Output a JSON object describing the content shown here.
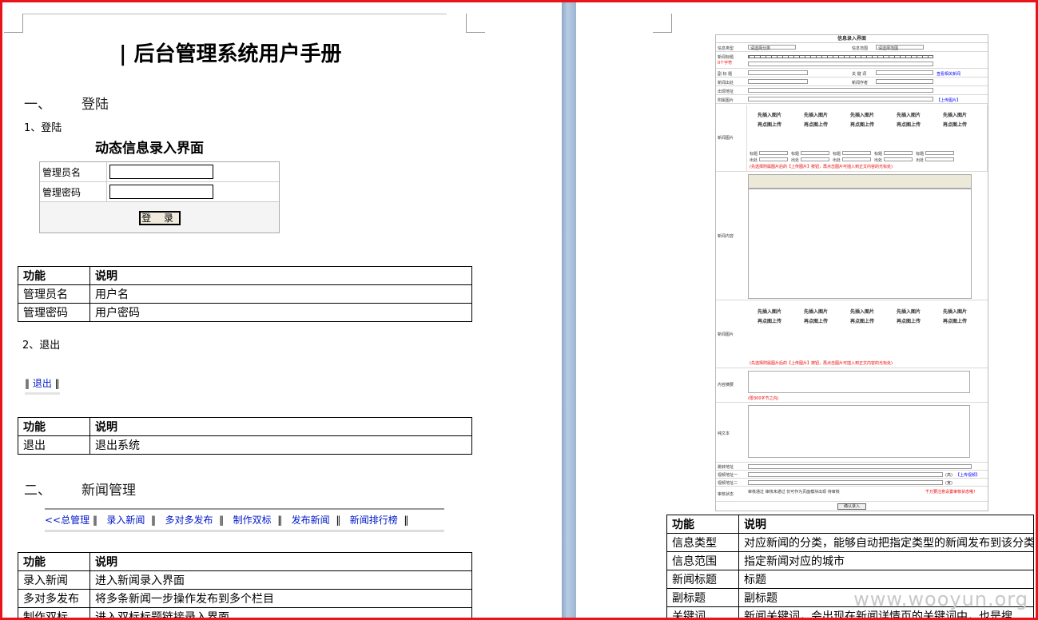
{
  "left": {
    "title": "| 后台管理系统用户手册",
    "section1": {
      "num": "一、",
      "label": "登陆"
    },
    "sub1": "1、登陆",
    "login": {
      "heading": "动态信息录入界面",
      "user_label": "管理员名",
      "pass_label": "管理密码",
      "button": "登 录"
    },
    "table1": {
      "headers": [
        "功能",
        "说明"
      ],
      "rows": [
        [
          "管理员名",
          "用户名"
        ],
        [
          "管理密码",
          "用户密码"
        ]
      ]
    },
    "sub2": "2、退出",
    "logout_link": "退出",
    "table2": {
      "headers": [
        "功能",
        "说明"
      ],
      "rows": [
        [
          "退出",
          "退出系统"
        ]
      ]
    },
    "section2": {
      "num": "二、",
      "label": "新闻管理"
    },
    "nav": [
      "<<总管理",
      "录入新闻",
      "多对多发布",
      "制作双标",
      "发布新闻",
      "新闻排行榜"
    ],
    "table3": {
      "headers": [
        "功能",
        "说明"
      ],
      "rows": [
        [
          "录入新闻",
          "进入新闻录入界面"
        ],
        [
          "多对多发布",
          "将多条新闻一步操作发布到多个栏目"
        ],
        [
          "制作双标",
          "进入双标标题链接录入界面"
        ]
      ]
    }
  },
  "right": {
    "shot": {
      "title": "信息录入界面",
      "rows": {
        "type": "信息类型",
        "type_sel": "请选择分类",
        "range": "信息范围",
        "range_sel": "请选择范围",
        "headline": "新闻标题",
        "headline_note": "0个字符",
        "subtitle": "副 标 题",
        "keyword": "关 键 词",
        "keyword_link": "查看相关新闻",
        "source": "新闻出处",
        "author": "新闻作者",
        "addr": "出现地址",
        "attach": "附属图片",
        "attach_link": "【上传图片】",
        "news_img": "新闻图片",
        "img_hint1": "先插入图片",
        "img_hint2": "再点图上传",
        "cap_title": "标题",
        "cap_src": "出处",
        "img_note": "(先选择附属图片后的【上传图片】按钮，再点击图片可插入到正文内容的光标处)",
        "content": "新闻内容",
        "summary": "内容摘要",
        "summary_note": "(限300字节之内)",
        "plain": "纯文本",
        "jump": "跳转地址",
        "video1": "视频地址一",
        "video1_link": "【上传视频】",
        "video2": "视频地址二",
        "video_unit": "(高)",
        "video_unit2": "(宽)",
        "audit": "审核状态",
        "audit_opts": "审核通过   审核未通过   仅可作为页面模块出现   待审核",
        "audit_note": "千万要注意设置审核状态哦！",
        "submit": "确认录入"
      }
    },
    "table": {
      "headers": [
        "功能",
        "说明"
      ],
      "rows": [
        [
          "信息类型",
          "对应新闻的分类，能够自动把指定类型的新闻发布到该分类"
        ],
        [
          "信息范围",
          "指定新闻对应的城市"
        ],
        [
          "新闻标题",
          "标题"
        ],
        [
          "副标题",
          "副标题"
        ],
        [
          "关键词",
          "新闻关键词，会出现在新闻详情页的关键词中，也是搜"
        ]
      ]
    },
    "watermark": "www.wooyun.org"
  }
}
